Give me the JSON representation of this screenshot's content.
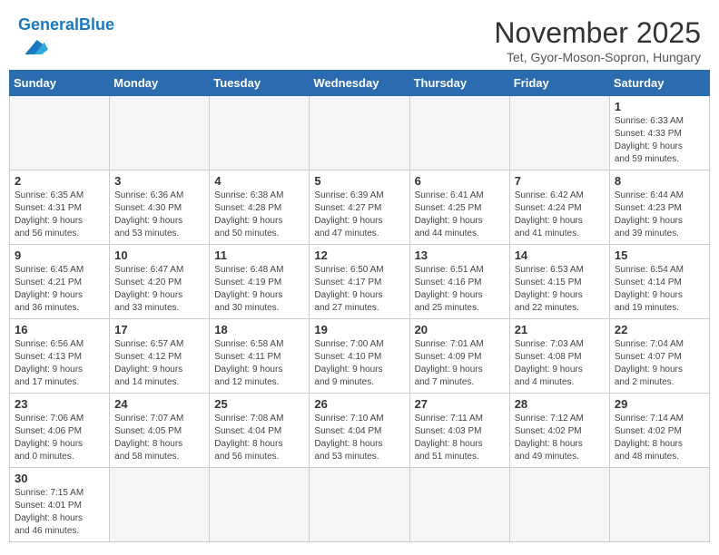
{
  "header": {
    "logo_text_general": "General",
    "logo_text_blue": "Blue",
    "title": "November 2025",
    "subtitle": "Tet, Gyor-Moson-Sopron, Hungary"
  },
  "weekdays": [
    "Sunday",
    "Monday",
    "Tuesday",
    "Wednesday",
    "Thursday",
    "Friday",
    "Saturday"
  ],
  "weeks": [
    [
      null,
      null,
      null,
      null,
      null,
      null,
      {
        "day": "1",
        "sunrise": "6:33 AM",
        "sunset": "4:33 PM",
        "daylight_h": "9",
        "daylight_m": "59"
      }
    ],
    [
      {
        "day": "2",
        "sunrise": "6:35 AM",
        "sunset": "4:31 PM",
        "daylight_h": "9",
        "daylight_m": "56"
      },
      {
        "day": "3",
        "sunrise": "6:36 AM",
        "sunset": "4:30 PM",
        "daylight_h": "9",
        "daylight_m": "53"
      },
      {
        "day": "4",
        "sunrise": "6:38 AM",
        "sunset": "4:28 PM",
        "daylight_h": "9",
        "daylight_m": "50"
      },
      {
        "day": "5",
        "sunrise": "6:39 AM",
        "sunset": "4:27 PM",
        "daylight_h": "9",
        "daylight_m": "47"
      },
      {
        "day": "6",
        "sunrise": "6:41 AM",
        "sunset": "4:25 PM",
        "daylight_h": "9",
        "daylight_m": "44"
      },
      {
        "day": "7",
        "sunrise": "6:42 AM",
        "sunset": "4:24 PM",
        "daylight_h": "9",
        "daylight_m": "41"
      },
      {
        "day": "8",
        "sunrise": "6:44 AM",
        "sunset": "4:23 PM",
        "daylight_h": "9",
        "daylight_m": "39"
      }
    ],
    [
      {
        "day": "9",
        "sunrise": "6:45 AM",
        "sunset": "4:21 PM",
        "daylight_h": "9",
        "daylight_m": "36"
      },
      {
        "day": "10",
        "sunrise": "6:47 AM",
        "sunset": "4:20 PM",
        "daylight_h": "9",
        "daylight_m": "33"
      },
      {
        "day": "11",
        "sunrise": "6:48 AM",
        "sunset": "4:19 PM",
        "daylight_h": "9",
        "daylight_m": "30"
      },
      {
        "day": "12",
        "sunrise": "6:50 AM",
        "sunset": "4:17 PM",
        "daylight_h": "9",
        "daylight_m": "27"
      },
      {
        "day": "13",
        "sunrise": "6:51 AM",
        "sunset": "4:16 PM",
        "daylight_h": "9",
        "daylight_m": "25"
      },
      {
        "day": "14",
        "sunrise": "6:53 AM",
        "sunset": "4:15 PM",
        "daylight_h": "9",
        "daylight_m": "22"
      },
      {
        "day": "15",
        "sunrise": "6:54 AM",
        "sunset": "4:14 PM",
        "daylight_h": "9",
        "daylight_m": "19"
      }
    ],
    [
      {
        "day": "16",
        "sunrise": "6:56 AM",
        "sunset": "4:13 PM",
        "daylight_h": "9",
        "daylight_m": "17"
      },
      {
        "day": "17",
        "sunrise": "6:57 AM",
        "sunset": "4:12 PM",
        "daylight_h": "9",
        "daylight_m": "14"
      },
      {
        "day": "18",
        "sunrise": "6:58 AM",
        "sunset": "4:11 PM",
        "daylight_h": "9",
        "daylight_m": "12"
      },
      {
        "day": "19",
        "sunrise": "7:00 AM",
        "sunset": "4:10 PM",
        "daylight_h": "9",
        "daylight_m": "9"
      },
      {
        "day": "20",
        "sunrise": "7:01 AM",
        "sunset": "4:09 PM",
        "daylight_h": "9",
        "daylight_m": "7"
      },
      {
        "day": "21",
        "sunrise": "7:03 AM",
        "sunset": "4:08 PM",
        "daylight_h": "9",
        "daylight_m": "4"
      },
      {
        "day": "22",
        "sunrise": "7:04 AM",
        "sunset": "4:07 PM",
        "daylight_h": "9",
        "daylight_m": "2"
      }
    ],
    [
      {
        "day": "23",
        "sunrise": "7:06 AM",
        "sunset": "4:06 PM",
        "daylight_h": "9",
        "daylight_m": "0"
      },
      {
        "day": "24",
        "sunrise": "7:07 AM",
        "sunset": "4:05 PM",
        "daylight_h": "8",
        "daylight_m": "58"
      },
      {
        "day": "25",
        "sunrise": "7:08 AM",
        "sunset": "4:04 PM",
        "daylight_h": "8",
        "daylight_m": "56"
      },
      {
        "day": "26",
        "sunrise": "7:10 AM",
        "sunset": "4:04 PM",
        "daylight_h": "8",
        "daylight_m": "53"
      },
      {
        "day": "27",
        "sunrise": "7:11 AM",
        "sunset": "4:03 PM",
        "daylight_h": "8",
        "daylight_m": "51"
      },
      {
        "day": "28",
        "sunrise": "7:12 AM",
        "sunset": "4:02 PM",
        "daylight_h": "8",
        "daylight_m": "49"
      },
      {
        "day": "29",
        "sunrise": "7:14 AM",
        "sunset": "4:02 PM",
        "daylight_h": "8",
        "daylight_m": "48"
      }
    ],
    [
      {
        "day": "30",
        "sunrise": "7:15 AM",
        "sunset": "4:01 PM",
        "daylight_h": "8",
        "daylight_m": "46"
      },
      null,
      null,
      null,
      null,
      null,
      null
    ]
  ]
}
